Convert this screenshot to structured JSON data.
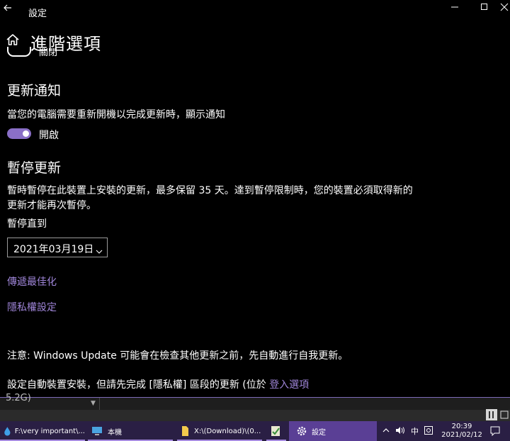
{
  "window": {
    "title": "設定"
  },
  "page": {
    "title": "進階選項"
  },
  "partial_toggle": {
    "label": "關閉"
  },
  "update_notify": {
    "heading": "更新通知",
    "description": "當您的電腦需要重新開機以完成更新時，顯示通知",
    "toggle_label": "開啟"
  },
  "pause_updates": {
    "heading": "暫停更新",
    "description_line1": "暫時暫停在此裝置上安裝的更新，最多保留 35 天。達到暫停限制時，您的裝置必須取得新的",
    "description_line2": "更新才能再次暫停。",
    "pause_until_label": "暫停直到",
    "selected_date": "2021年03月19日"
  },
  "links": {
    "delivery_optimization": "傳遞最佳化",
    "privacy_settings": "隱私權設定"
  },
  "notes": {
    "note1": "注意: Windows Update 可能會在檢查其他更新之前，先自動進行自我更新。",
    "note2_prefix": "設定自動裝置安裝，但請先完成 [隱私權] 區段的更新 (位於 ",
    "note2_link": "登入選項"
  },
  "behind_window": {
    "cut_text": "5.2G)"
  },
  "taskbar": {
    "items": [
      {
        "label": "F:\\very important\\..."
      },
      {
        "label": "本機"
      },
      {
        "label": "X:\\(Download)\\(0..."
      },
      {
        "label": ""
      },
      {
        "label": "設定"
      }
    ],
    "ime": "中",
    "time": "20:39",
    "date": "2021/02/12"
  },
  "colors": {
    "accent": "#8a6fc7",
    "link": "#9f85d8",
    "taskbar": "#2a1f44"
  }
}
